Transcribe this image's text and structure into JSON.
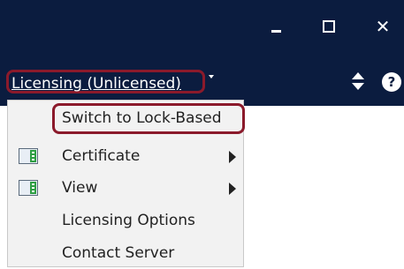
{
  "toolbar": {
    "menu_label": "Licensing (Unlicensed)",
    "help_label": "?"
  },
  "window_controls": {
    "minimize": "minimize-icon",
    "maximize": "maximize-icon",
    "close": "✕"
  },
  "dropdown": {
    "items": [
      {
        "label": "Switch to Lock-Based",
        "icon": null,
        "submenu": false
      },
      {
        "label": "Certificate",
        "icon": "panel-icon",
        "submenu": true
      },
      {
        "label": "View",
        "icon": "panel-icon",
        "submenu": true
      },
      {
        "label": "Licensing Options",
        "icon": null,
        "submenu": false
      },
      {
        "label": "Contact Server",
        "icon": null,
        "submenu": false
      }
    ]
  },
  "colors": {
    "titlebar": "#0b1c3f",
    "highlight_border": "#8b1a2b",
    "menu_bg": "#f2f2f2",
    "icon_green": "#2f9e44"
  }
}
